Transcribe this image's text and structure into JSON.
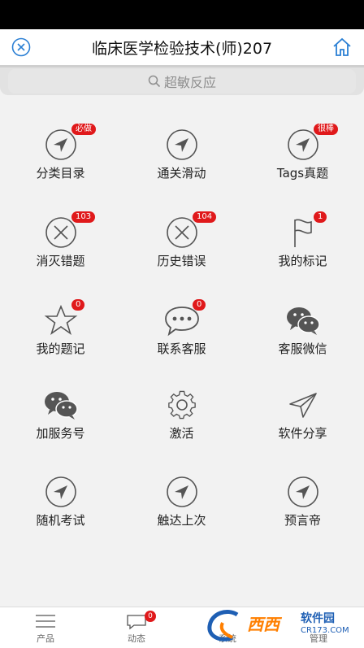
{
  "header": {
    "title": "临床医学检验技术(师)207"
  },
  "search": {
    "text": "超敏反应"
  },
  "grid": {
    "items": [
      {
        "label": "分类目录",
        "badge": "必做",
        "icon": "nav-arrow-icon"
      },
      {
        "label": "通关滑动",
        "badge": "",
        "icon": "nav-arrow-icon"
      },
      {
        "label": "Tags真题",
        "badge": "很棒",
        "icon": "nav-arrow-icon"
      },
      {
        "label": "消灭错题",
        "badge": "103",
        "icon": "x-circle-icon"
      },
      {
        "label": "历史错误",
        "badge": "104",
        "icon": "x-circle-icon"
      },
      {
        "label": "我的标记",
        "badge": "1",
        "icon": "flag-icon"
      },
      {
        "label": "我的题记",
        "badge": "0",
        "icon": "star-icon"
      },
      {
        "label": "联系客服",
        "badge": "0",
        "icon": "chat-bubble-icon"
      },
      {
        "label": "客服微信",
        "badge": "",
        "icon": "wechat-icon"
      },
      {
        "label": "加服务号",
        "badge": "",
        "icon": "wechat-icon"
      },
      {
        "label": "激活",
        "badge": "",
        "icon": "gear-icon"
      },
      {
        "label": "软件分享",
        "badge": "",
        "icon": "send-icon"
      },
      {
        "label": "随机考试",
        "badge": "",
        "icon": "nav-arrow-icon"
      },
      {
        "label": "触达上次",
        "badge": "",
        "icon": "nav-arrow-icon"
      },
      {
        "label": "预言帝",
        "badge": "",
        "icon": "nav-arrow-icon"
      }
    ]
  },
  "tabbar": {
    "tabs": [
      {
        "label": "产品",
        "badge": ""
      },
      {
        "label": "动态",
        "badge": "0"
      },
      {
        "label": "系统",
        "badge": ""
      },
      {
        "label": "管理",
        "badge": ""
      }
    ]
  },
  "watermark": {
    "main": "西西",
    "sub": "软件园",
    "url": "CR173.COM"
  },
  "colors": {
    "badge": "#e0191b",
    "icon_stroke": "#555555",
    "watermark_orange": "#ff7f00",
    "watermark_blue": "#1e5fb4"
  }
}
